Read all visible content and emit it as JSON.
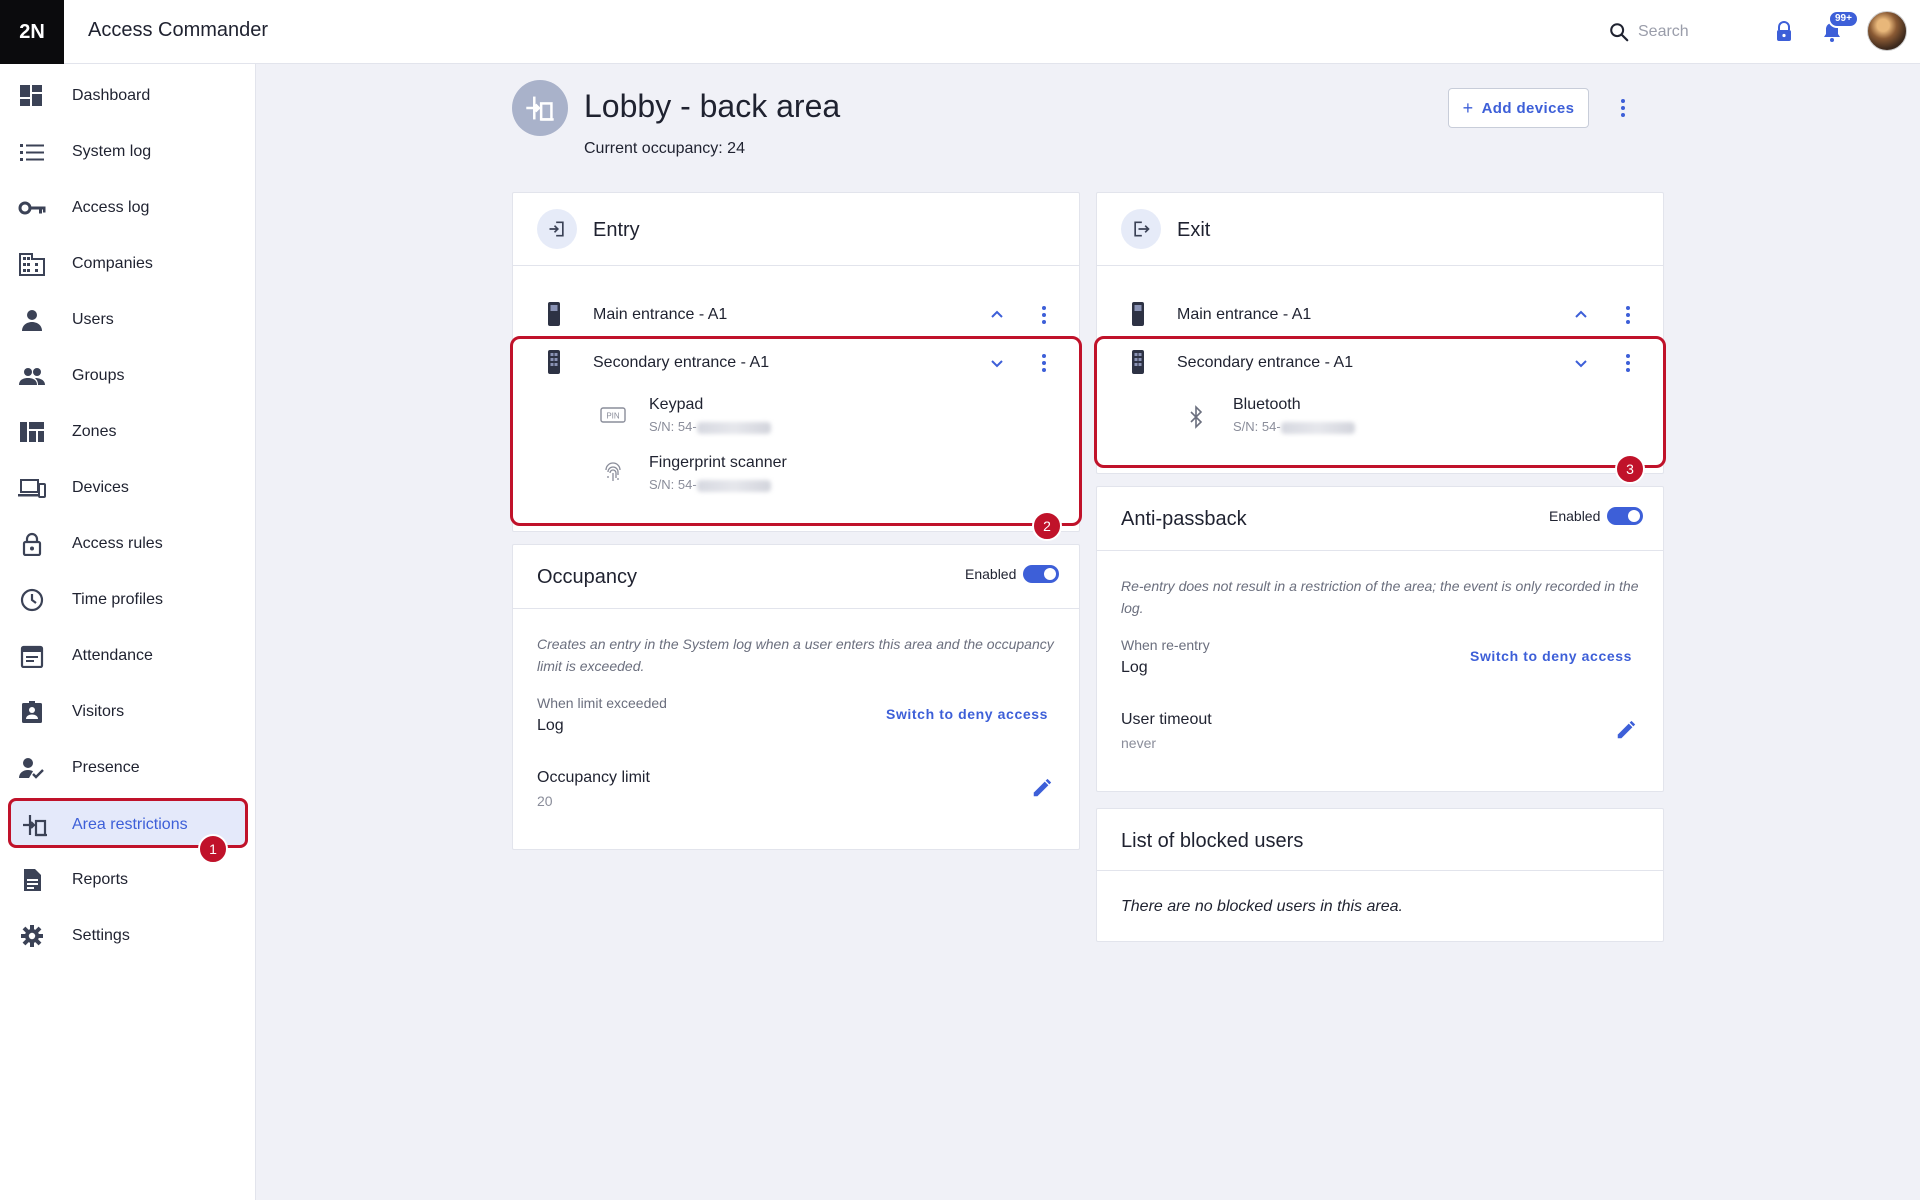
{
  "app": {
    "logo": "2N",
    "title": "Access Commander"
  },
  "topbar": {
    "search_placeholder": "Search",
    "notif_badge": "99+"
  },
  "sidebar": {
    "items": [
      {
        "label": "Dashboard",
        "icon": "dashboard-icon"
      },
      {
        "label": "System log",
        "icon": "list-icon"
      },
      {
        "label": "Access log",
        "icon": "key-icon"
      },
      {
        "label": "Companies",
        "icon": "building-icon"
      },
      {
        "label": "Users",
        "icon": "person-icon"
      },
      {
        "label": "Groups",
        "icon": "people-icon"
      },
      {
        "label": "Zones",
        "icon": "zones-icon"
      },
      {
        "label": "Devices",
        "icon": "devices-icon"
      },
      {
        "label": "Access rules",
        "icon": "lock-icon"
      },
      {
        "label": "Time profiles",
        "icon": "clock-icon"
      },
      {
        "label": "Attendance",
        "icon": "calendar-icon"
      },
      {
        "label": "Visitors",
        "icon": "visitor-badge-icon"
      },
      {
        "label": "Presence",
        "icon": "person-check-icon"
      },
      {
        "label": "Area restrictions",
        "icon": "area-restriction-icon"
      },
      {
        "label": "Reports",
        "icon": "report-icon"
      },
      {
        "label": "Settings",
        "icon": "gear-icon"
      }
    ],
    "active": "Area restrictions"
  },
  "page": {
    "title": "Lobby - back area",
    "occupancy_text": "Current occupancy: 24",
    "add_devices_label": "Add devices"
  },
  "entry": {
    "title": "Entry",
    "devices": [
      {
        "name": "Main entrance - A1",
        "expanded": false
      },
      {
        "name": "Secondary entrance - A1",
        "expanded": true,
        "modules": [
          {
            "name": "Keypad",
            "sn": "S/N: 54-",
            "icon": "pin-icon"
          },
          {
            "name": "Fingerprint scanner",
            "sn": "S/N: 54-",
            "icon": "fingerprint-icon"
          }
        ]
      }
    ]
  },
  "exit": {
    "title": "Exit",
    "devices": [
      {
        "name": "Main entrance - A1",
        "expanded": false
      },
      {
        "name": "Secondary entrance - A1",
        "expanded": true,
        "modules": [
          {
            "name": "Bluetooth",
            "sn": "S/N: 54-",
            "icon": "bluetooth-icon"
          }
        ]
      }
    ]
  },
  "occupancy": {
    "title": "Occupancy",
    "enabled_label": "Enabled",
    "enabled": true,
    "description": "Creates an entry in the System log when a user enters this area and the occupancy limit is exceeded.",
    "when_label": "When limit exceeded",
    "when_value": "Log",
    "switch_label": "Switch to deny access",
    "limit_label": "Occupancy limit",
    "limit_value": "20"
  },
  "antipassback": {
    "title": "Anti-passback",
    "enabled_label": "Enabled",
    "enabled": true,
    "description": "Re-entry does not result in a restriction of the area; the event is only recorded in the log.",
    "when_label": "When re-entry",
    "when_value": "Log",
    "switch_label": "Switch to deny access",
    "timeout_label": "User timeout",
    "timeout_value": "never"
  },
  "blocked": {
    "title": "List of blocked users",
    "empty_text": "There are no blocked users in this area."
  },
  "markers": [
    "1",
    "2",
    "3"
  ],
  "colors": {
    "accent": "#3d5fd8",
    "highlight": "#c0122a",
    "background": "#f0f1f7"
  }
}
